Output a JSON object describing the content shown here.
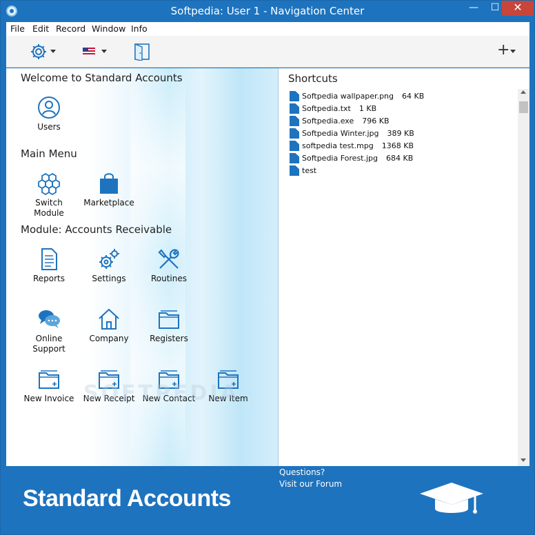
{
  "window": {
    "title": "Softpedia: User 1 - Navigation Center",
    "minimize": "—",
    "maximize": "☐",
    "close": "✕"
  },
  "menu": [
    "File",
    "Edit",
    "Record",
    "Window",
    "Info"
  ],
  "toolbar": {
    "settings_icon": "gear-icon",
    "language_icon": "us-flag-icon",
    "exit_icon": "door-icon",
    "add_label": "+"
  },
  "left": {
    "welcome_title": "Welcome to Standard Accounts",
    "users_label": "Users",
    "main_menu_title": "Main Menu",
    "switch_module_label": "Switch Module",
    "marketplace_label": "Marketplace",
    "module_title": "Module:  Accounts Receivable",
    "reports_label": "Reports",
    "settings_label": "Settings",
    "routines_label": "Routines",
    "online_support_label": "Online Support",
    "company_label": "Company",
    "registers_label": "Registers",
    "new_invoice_label": "New Invoice",
    "new_receipt_label": "New Receipt",
    "new_contact_label": "New Contact",
    "new_item_label": "New Item"
  },
  "shortcuts": {
    "title": "Shortcuts",
    "items": [
      {
        "name": "Softpedia wallpaper.png",
        "size": "64 KB"
      },
      {
        "name": "Softpedia.txt",
        "size": "1 KB"
      },
      {
        "name": "Softpedia.exe",
        "size": "796 KB"
      },
      {
        "name": "Softpedia Winter.jpg",
        "size": "389 KB"
      },
      {
        "name": "softpedia test.mpg",
        "size": "1368 KB"
      },
      {
        "name": "Softpedia Forest.jpg",
        "size": "684 KB"
      },
      {
        "name": "test",
        "size": ""
      }
    ]
  },
  "footer": {
    "brand": "Standard Accounts",
    "questions": "Questions?",
    "forum_link": "Visit our Forum"
  },
  "watermark": "SOFTPEDIA",
  "colors": {
    "accent": "#1e73be",
    "close_button": "#c7453a",
    "icon_blue": "#1e73be"
  }
}
